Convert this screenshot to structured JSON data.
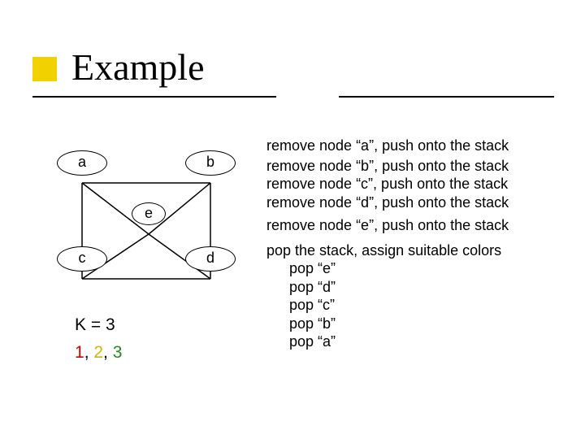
{
  "title": "Example",
  "graph": {
    "labels": {
      "a": "a",
      "b": "b",
      "c": "c",
      "d": "d",
      "e": "e"
    }
  },
  "k_line": "K = 3",
  "colors": {
    "c1": "1",
    "sep1": ", ",
    "c2": "2",
    "sep2": ", ",
    "c3": "3"
  },
  "steps": {
    "rm_a": "remove node “a”, push onto the stack",
    "rm_b": "remove node “b”, push onto the stack",
    "rm_c": "remove node “c”, push onto the stack",
    "rm_d": "remove node “d”, push onto the stack",
    "rm_e": "remove node “e”, push onto the stack",
    "pop_head": "pop the stack, assign suitable colors",
    "pop_e": "pop “e”",
    "pop_d": "pop “d”",
    "pop_c": "pop “c”",
    "pop_b": "pop “b”",
    "pop_a": "pop “a”"
  }
}
